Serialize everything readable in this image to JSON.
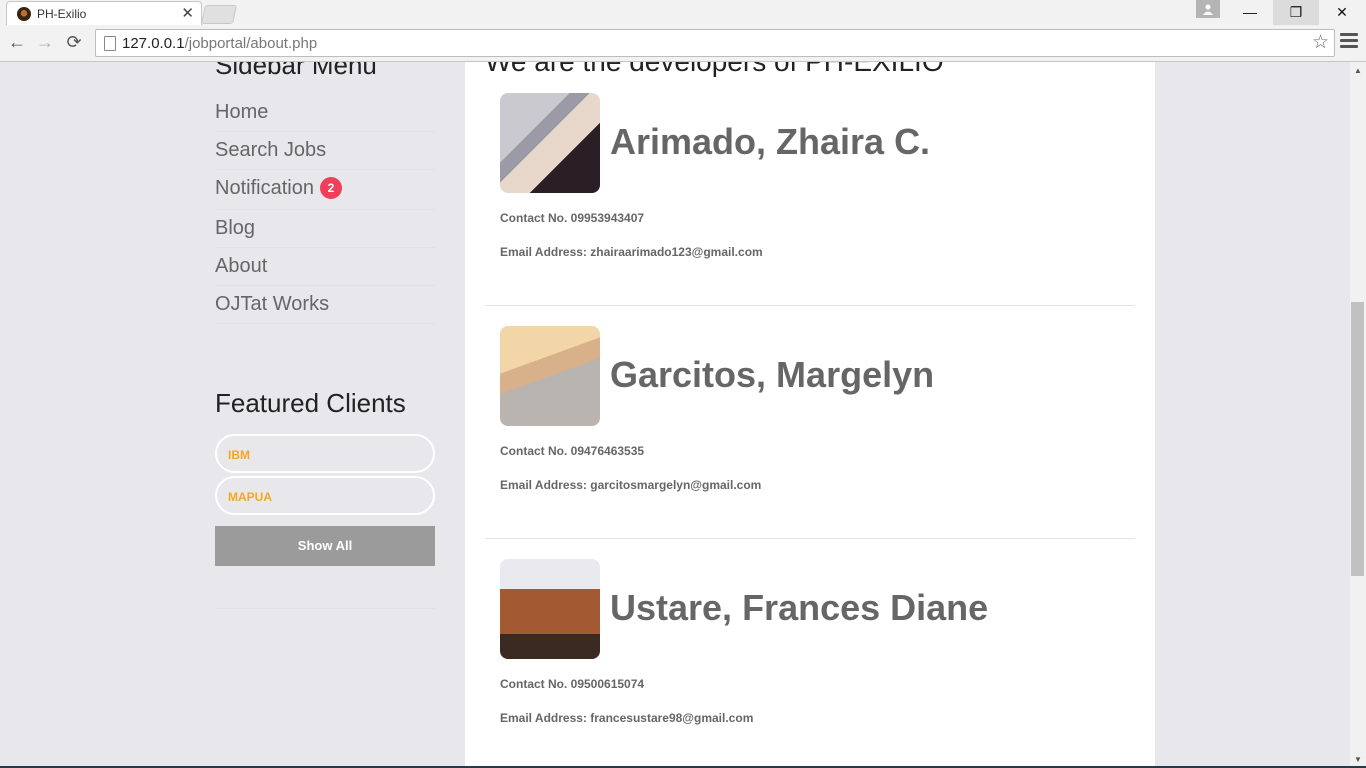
{
  "browser": {
    "tab_title": "PH-Exilio",
    "tab_close": "✕",
    "url_host": "127.0.0.1",
    "url_path": "/jobportal/about.php",
    "win_min": "—",
    "win_max": "❐",
    "win_close": "✕",
    "back": "←",
    "forward": "→",
    "reload": "⟳",
    "star": "☆"
  },
  "sidebar": {
    "title": "Sidebar Menu",
    "items": [
      {
        "label": "Home"
      },
      {
        "label": "Search Jobs"
      },
      {
        "label": "Notification",
        "badge": "2"
      },
      {
        "label": "Blog"
      },
      {
        "label": "About"
      },
      {
        "label": "OJTat Works"
      }
    ],
    "featured_title": "Featured Clients",
    "clients": [
      "IBM",
      "MAPUA"
    ],
    "show_all": "Show All"
  },
  "main": {
    "heading": "We are the developers of PH-EXILIO",
    "developers": [
      {
        "name": "Arimado, Zhaira C.",
        "contact": "Contact No. 09953943407",
        "email": "Email Address: zhairaarimado123@gmail.com"
      },
      {
        "name": "Garcitos, Margelyn",
        "contact": "Contact No. 09476463535",
        "email": "Email Address: garcitosmargelyn@gmail.com"
      },
      {
        "name": "Ustare, Frances Diane",
        "contact": "Contact No. 09500615074",
        "email": "Email Address: francesustare98@gmail.com"
      }
    ]
  },
  "colors": {
    "badge": "#f03e5b",
    "client_link": "#f5a623",
    "button": "#9b9b9b"
  }
}
